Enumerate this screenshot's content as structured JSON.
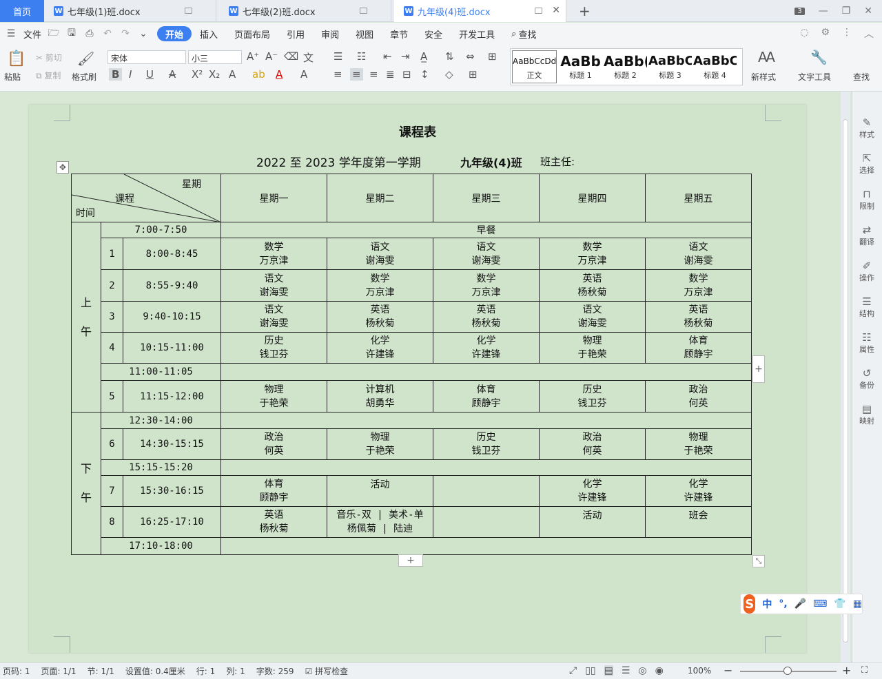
{
  "tabs": {
    "home": "首页",
    "docs": [
      {
        "title": "七年级(1)班.docx",
        "active": false
      },
      {
        "title": "七年级(2)班.docx",
        "active": false
      },
      {
        "title": "九年级(4)班.docx",
        "active": true
      }
    ],
    "window_badge": "3"
  },
  "menu": {
    "file": "文件",
    "items": [
      "开始",
      "插入",
      "页面布局",
      "引用",
      "审阅",
      "视图",
      "章节",
      "安全",
      "开发工具"
    ],
    "active": "开始",
    "search": "查找"
  },
  "ribbon": {
    "paste": "粘贴",
    "cut": "剪切",
    "copy": "复制",
    "format_painter": "格式刷",
    "font_name": "宋体",
    "font_size": "小三",
    "styles": [
      {
        "preview": "AaBbCcDd",
        "name": "正文"
      },
      {
        "preview": "AaBb",
        "name": "标题 1"
      },
      {
        "preview": "AaBb(",
        "name": "标题 2"
      },
      {
        "preview": "AaBbC(",
        "name": "标题 3"
      },
      {
        "preview": "AaBbC",
        "name": "标题 4"
      }
    ],
    "new_style": "新样式",
    "text_tools": "文字工具",
    "find": "查找"
  },
  "document": {
    "title": "课程表",
    "term": "2022 至 2023 学年度第一学期",
    "class_name": "九年级(4)班",
    "teacher_label": "班主任:",
    "header": {
      "diag_top": "星期",
      "diag_mid": "课程",
      "diag_bottom": "时间",
      "days": [
        "星期一",
        "星期二",
        "星期三",
        "星期四",
        "星期五"
      ]
    },
    "breakfast_time": "7:00-7:50",
    "breakfast_label": "早餐",
    "morning_label_1": "上",
    "morning_label_2": "午",
    "afternoon_label_1": "下",
    "afternoon_label_2": "午",
    "morning": [
      {
        "num": "1",
        "time": "8:00-8:45",
        "cells": [
          [
            "数学",
            "万京津"
          ],
          [
            "语文",
            "谢海雯"
          ],
          [
            "语文",
            "谢海雯"
          ],
          [
            "数学",
            "万京津"
          ],
          [
            "语文",
            "谢海雯"
          ]
        ]
      },
      {
        "num": "2",
        "time": "8:55-9:40",
        "cells": [
          [
            "语文",
            "谢海雯"
          ],
          [
            "数学",
            "万京津"
          ],
          [
            "数学",
            "万京津"
          ],
          [
            "英语",
            "杨秋菊"
          ],
          [
            "数学",
            "万京津"
          ]
        ]
      },
      {
        "num": "3",
        "time": "9:40-10:15",
        "cells": [
          [
            "语文",
            "谢海雯"
          ],
          [
            "英语",
            "杨秋菊"
          ],
          [
            "英语",
            "杨秋菊"
          ],
          [
            "语文",
            "谢海雯"
          ],
          [
            "英语",
            "杨秋菊"
          ]
        ]
      },
      {
        "num": "4",
        "time": "10:15-11:00",
        "cells": [
          [
            "历史",
            "钱卫芬"
          ],
          [
            "化学",
            "许建锋"
          ],
          [
            "化学",
            "许建锋"
          ],
          [
            "物理",
            "于艳荣"
          ],
          [
            "体育",
            "顾静宇"
          ]
        ]
      }
    ],
    "break1": "11:00-11:05",
    "period5": {
      "num": "5",
      "time": "11:15-12:00",
      "cells": [
        [
          "物理",
          "于艳荣"
        ],
        [
          "计算机",
          "胡勇华"
        ],
        [
          "体育",
          "顾静宇"
        ],
        [
          "历史",
          "钱卫芬"
        ],
        [
          "政治",
          "何英"
        ]
      ]
    },
    "lunch": "12:30-14:00",
    "period6": {
      "num": "6",
      "time": "14:30-15:15",
      "cells": [
        [
          "政治",
          "何英"
        ],
        [
          "物理",
          "于艳荣"
        ],
        [
          "历史",
          "钱卫芬"
        ],
        [
          "政治",
          "何英"
        ],
        [
          "物理",
          "于艳荣"
        ]
      ]
    },
    "break2": "15:15-15:20",
    "period7": {
      "num": "7",
      "time": "15:30-16:15",
      "cells": [
        [
          "体育",
          "顾静宇"
        ],
        [
          "活动",
          ""
        ],
        [
          "",
          ""
        ],
        [
          "化学",
          "许建锋"
        ],
        [
          "化学",
          "许建锋"
        ]
      ]
    },
    "period8": {
      "num": "8",
      "time": "16:25-17:10",
      "cells": [
        [
          "英语",
          "杨秋菊"
        ],
        [
          "音乐-双 | 美术-单",
          "杨佩菊 | 陆迪"
        ],
        [
          "",
          ""
        ],
        [
          "活动",
          ""
        ],
        [
          "班会",
          ""
        ]
      ]
    },
    "end_time": "17:10-18:00"
  },
  "sidebar": [
    "样式",
    "选择",
    "限制",
    "翻译",
    "操作",
    "结构",
    "属性",
    "备份",
    "映射"
  ],
  "status": {
    "page_num": "页码: 1",
    "pages": "页面: 1/1",
    "section": "节: 1/1",
    "setting": "设置值: 0.4厘米",
    "row": "行: 1",
    "col": "列: 1",
    "words": "字数: 259",
    "spellcheck": "拼写检查",
    "zoom": "100%"
  },
  "ime": {
    "lang": "中"
  }
}
